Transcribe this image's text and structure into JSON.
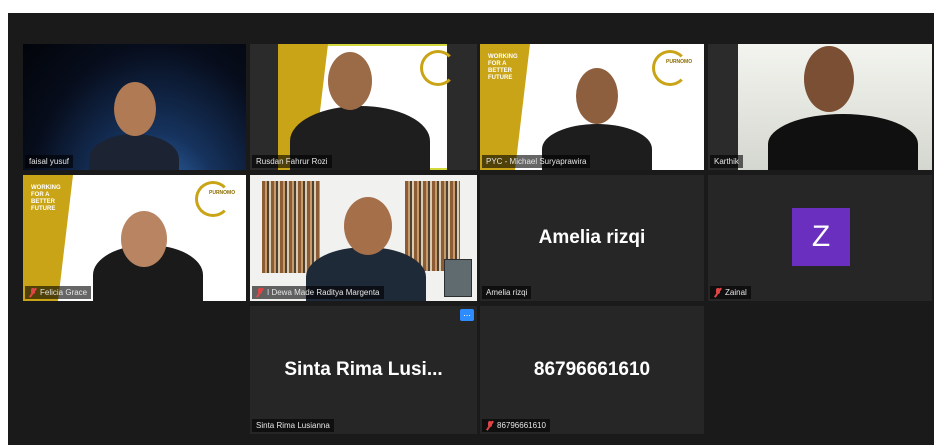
{
  "participants": {
    "faisal": {
      "name": "faisal yusuf"
    },
    "rusdan": {
      "name": "Rusdan Fahrur Rozi"
    },
    "pyc": {
      "name": "PYC - Michael Suryaprawira",
      "bg_text": "WORKING FOR A BETTER FUTURE",
      "brand": "PURNOMO"
    },
    "karthik": {
      "name": "Karthik"
    },
    "felicia": {
      "name": "Felicia Grace",
      "bg_text": "WORKING FOR A BETTER FUTURE",
      "brand": "PURNOMO"
    },
    "dewa": {
      "name": "I Dewa Made Raditya Margenta"
    },
    "amelia": {
      "display": "Amelia rizqi",
      "name": "Amelia rizqi"
    },
    "zainal": {
      "avatar_letter": "Z",
      "name": "Zainal"
    },
    "sinta": {
      "display": "Sinta Rima Lusi...",
      "name": "Sinta Rima Lusianna",
      "more_icon": "..."
    },
    "phone": {
      "display": "86796661610",
      "name": "86796661610"
    }
  },
  "colors": {
    "active_border": "#d3d83a",
    "brand_gold": "#c9a416",
    "avatar_purple": "#6b2fbf",
    "mute_red": "#e04545"
  }
}
